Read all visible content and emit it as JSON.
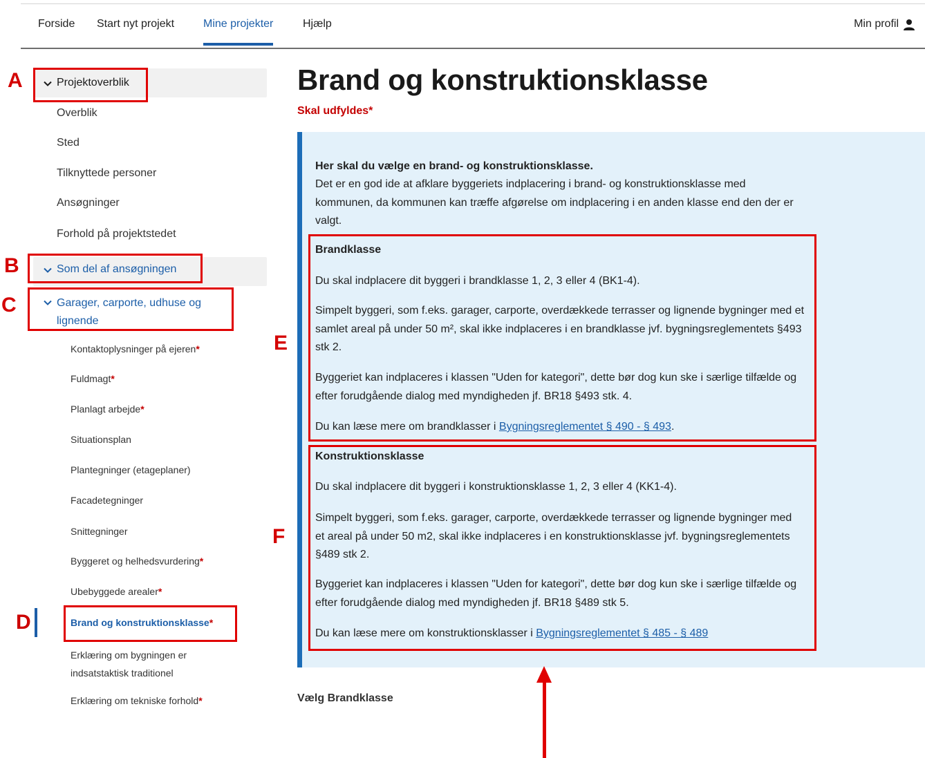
{
  "nav": {
    "items": [
      {
        "label": "Forside"
      },
      {
        "label": "Start nyt projekt"
      },
      {
        "label": "Mine projekter"
      },
      {
        "label": "Hjælp"
      }
    ],
    "active_index": 2,
    "profile_label": "Min profil",
    "profile_icon": "person-icon"
  },
  "sidebar": {
    "overview_header": "Projektoverblik",
    "overview_links": [
      "Overblik",
      "Sted",
      "Tilknyttede personer",
      "Ansøgninger",
      "Forhold på projektstedet"
    ],
    "application_header": "Som del af ansøgningen",
    "category_header": "Garager, carporte, udhuse og lignende",
    "category_header_lines": [
      "Garager, carporte, udhuse og",
      "lignende"
    ],
    "sub_items": [
      {
        "label": "Kontaktoplysninger på ejeren",
        "required": true
      },
      {
        "label": "Fuldmagt",
        "required": true
      },
      {
        "label": "Planlagt arbejde",
        "required": true
      },
      {
        "label": "Situationsplan",
        "required": false
      },
      {
        "label": "Plantegninger (etageplaner)",
        "required": false
      },
      {
        "label": "Facadetegninger",
        "required": false
      },
      {
        "label": "Snittegninger",
        "required": false
      },
      {
        "label": "Byggeret og helhedsvurdering",
        "required": true
      },
      {
        "label": "Ubebyggede arealer",
        "required": true
      },
      {
        "label": "Brand og konstruktionsklasse",
        "required": true,
        "current": true
      },
      {
        "label": "Erklæring om bygningen er indsatstaktisk traditionel",
        "lines": [
          "Erklæring om bygningen er",
          "indsatstaktisk traditionel"
        ],
        "required": false
      },
      {
        "label": "Erklæring om tekniske forhold",
        "required": true
      }
    ],
    "required_mark": "*"
  },
  "main": {
    "title": "Brand og konstruktionsklasse",
    "required_text": "Skal udfyldes",
    "required_mark": "*",
    "intro_heading": "Her skal du vælge en brand- og konstruktionsklasse.",
    "intro_text": "Det er en god ide at afklare byggeriets indplacering i brand- og konstruktionsklasse med kommunen, da kommunen kan træffe afgørelse om indplacering i en anden klasse end den der er valgt.",
    "brand": {
      "heading": "Brandklasse",
      "p1": "Du skal indplacere dit byggeri i brandklasse 1, 2, 3 eller 4 (BK1-4).",
      "p2": "Simpelt byggeri, som f.eks. garager, carporte, overdækkede terrasser og lignende bygninger med et samlet areal på under 50 m², skal ikke indplaceres i en brandklasse jvf. bygningsreglementets §493 stk 2.",
      "p3": "Byggeriet kan indplaceres i klassen \"Uden for kategori\", dette bør dog kun ske i særlige tilfælde og efter forudgående dialog med myndigheden jf. BR18 §493 stk. 4.",
      "read_more": "Du kan læse mere om brandklasser i ",
      "link": "Bygningsreglementet § 490 - § 493",
      "after_link": "."
    },
    "konstruktion": {
      "heading": "Konstruktionsklasse",
      "p1": "Du skal indplacere dit byggeri i konstruktionsklasse 1, 2, 3 eller 4 (KK1-4).",
      "p2": "Simpelt byggeri, som f.eks. garager, carporte, overdækkede terrasser og lignende bygninger med et areal på under 50 m2, skal ikke indplaceres i en konstruktionsklasse jvf. bygningsreglementets §489 stk 2.",
      "p3": "Byggeriet kan indplaceres i klassen \"Uden for kategori\", dette bør dog kun ske i særlige tilfælde og efter forudgående dialog med myndigheden jf. BR18 §489 stk 5.",
      "read_more": "Du kan læse mere om konstruktionsklasser i ",
      "link": "Bygningsreglementet § 485 - § 489"
    },
    "choose_label": "Vælg Brandklasse"
  },
  "annotations": {
    "markers": [
      "A",
      "B",
      "C",
      "D",
      "E",
      "F"
    ],
    "color": "#e00000"
  },
  "colors": {
    "accent_blue": "#1c5ea8",
    "info_bg": "#e3f1fa",
    "required_red": "#c40000"
  }
}
